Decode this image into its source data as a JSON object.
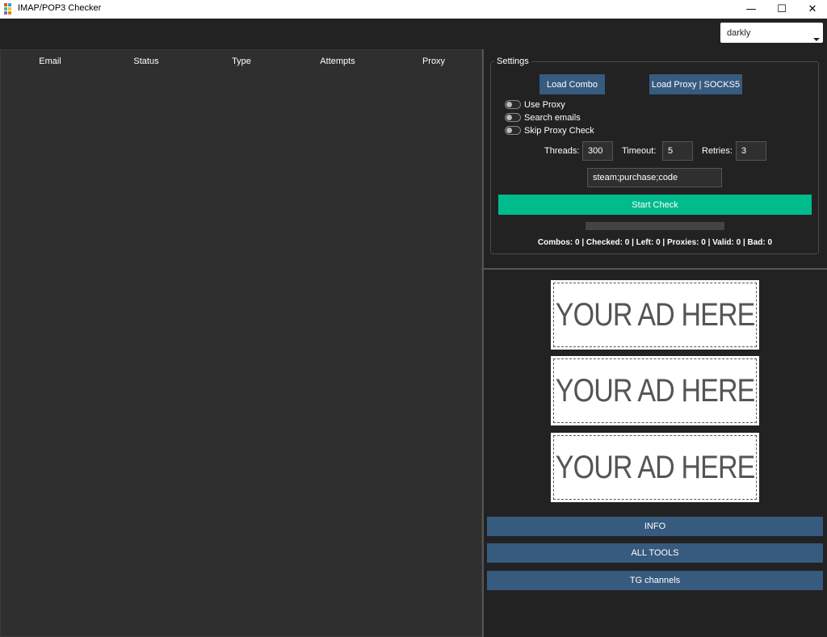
{
  "window": {
    "title": "IMAP/POP3 Checker",
    "minimize_label": "—",
    "maximize_label": "☐",
    "close_label": "✕"
  },
  "theme": {
    "selected": "darkly"
  },
  "table": {
    "columns": [
      "Email",
      "Status",
      "Type",
      "Attempts",
      "Proxy"
    ],
    "rows": []
  },
  "settings": {
    "legend": "Settings",
    "load_combo": "Load Combo",
    "load_proxy": "Load Proxy | SOCKS5",
    "toggles": [
      {
        "label": "Use Proxy",
        "on": false
      },
      {
        "label": "Search emails",
        "on": false
      },
      {
        "label": "Skip Proxy Check",
        "on": false
      }
    ],
    "threads_label": "Threads:",
    "threads_value": "300",
    "timeout_label": "Timeout:",
    "timeout_value": "5",
    "retries_label": "Retries:",
    "retries_value": "3",
    "search_value": "steam;purchase;code",
    "start_label": "Start Check",
    "progress": 0,
    "stats": "Combos: 0 | Checked: 0 | Left: 0 | Proxies: 0 | Valid: 0 | Bad: 0"
  },
  "ads": [
    "YOUR AD HERE",
    "YOUR AD HERE",
    "YOUR AD HERE"
  ],
  "links": {
    "info": "INFO",
    "all_tools": "ALL TOOLS",
    "tg_channels": "TG channels"
  },
  "colors": {
    "background": "#222222",
    "panel": "#2f2f2f",
    "primary": "#375a7f",
    "success": "#00bc8c"
  }
}
